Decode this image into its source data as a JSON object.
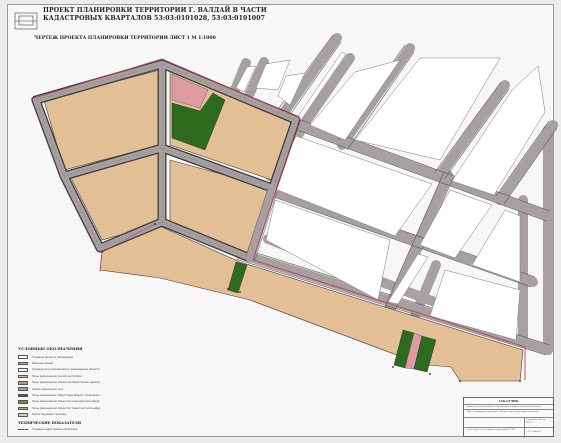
{
  "title": "ПРОЕКТ ПЛАНИРОВКИ ТЕРРИТОРИИ Г. ВАЛДАЙ В ЧАСТИ КАДАСТРОВЫХ КВАРТАЛОВ 53:03:0101028, 53:03:0101007",
  "subtitle": "ЧЕРТЕЖ ПРОЕКТА ПЛАНИРОВКИ ТЕРРИТОРИИ ЛИСТ 1   М 1:1000",
  "legend": {
    "title": "УСЛОВНЫЕ ОБОЗНАЧЕНИЯ",
    "items": [
      {
        "color": "#ffffff",
        "label": "Границы проекта планировки"
      },
      {
        "color": "#dc9aa3",
        "label": "Красные линии"
      },
      {
        "color": "#f2f2f2",
        "label": "Границы зон планируемого размещения объектов капитального строительства"
      },
      {
        "color": "#e3bf95",
        "label": "Зоны размещения жилой застройки"
      },
      {
        "color": "#c59a6c",
        "label": "Зоны размещения объектов общественно-делового назначения"
      },
      {
        "color": "#a7a0a0",
        "label": "Улично-дорожная сеть"
      },
      {
        "color": "#2f6b1f",
        "label": "Зоны озеленения территорий общего пользования"
      },
      {
        "color": "#6f8f4f",
        "label": "Зоны размещения объектов инженерной инфраструктуры"
      },
      {
        "color": "#c7a27c",
        "label": "Зоны размещения объектов транспортной инфраструктуры"
      },
      {
        "color": "#cfcfcf",
        "label": "Проектируемые проезды"
      }
    ]
  },
  "legend2": {
    "title": "ТЕХНИЧЕСКИЕ ПОКАЗАТЕЛИ",
    "row_label": "Граница кадастровых кварталов"
  },
  "stamp": {
    "title": "ЗАКАЗЧИК",
    "line1": "Администрация Валдайского муниципального района Новгородской области",
    "line2": "Проект планировки территории г. Валдай в части кадастровых кварталов",
    "line3": "Стадия   Лист   Листов",
    "line4": "ПП   1   2",
    "line5": "Чертеж проекта планировки территории   М 1:1000",
    "org": "ООО \"Кадастр\""
  },
  "colors": {
    "residential": "#e3bf95",
    "road": "#a7a0a0",
    "road_edge": "#3d3d3d",
    "green": "#2f6b1f",
    "pink": "#dc9aa3",
    "red_line": "#c23a55",
    "block": "#ffffff"
  }
}
